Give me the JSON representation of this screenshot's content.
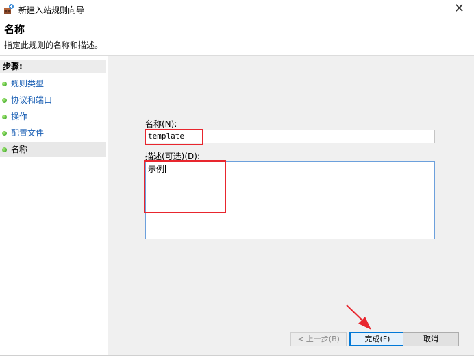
{
  "window": {
    "title": "新建入站规则向导",
    "close_glyph": "✕"
  },
  "header": {
    "title": "名称",
    "subtitle": "指定此规则的名称和描述。"
  },
  "sidebar": {
    "title": "步骤:",
    "items": [
      {
        "label": "规则类型",
        "current": false
      },
      {
        "label": "协议和端口",
        "current": false
      },
      {
        "label": "操作",
        "current": false
      },
      {
        "label": "配置文件",
        "current": false
      },
      {
        "label": "名称",
        "current": true
      }
    ]
  },
  "form": {
    "name_label": "名称(N):",
    "name_value": "template",
    "desc_label": "描述(可选)(D):",
    "desc_value": "示例"
  },
  "buttons": {
    "back": "< 上一步(B)",
    "finish": "完成(F)",
    "cancel": "取消"
  },
  "colors": {
    "highlight": "#e8262e",
    "step_link": "#1a5fb4",
    "step_dot": "#2e9b1c",
    "focus_border": "#0078d7"
  }
}
